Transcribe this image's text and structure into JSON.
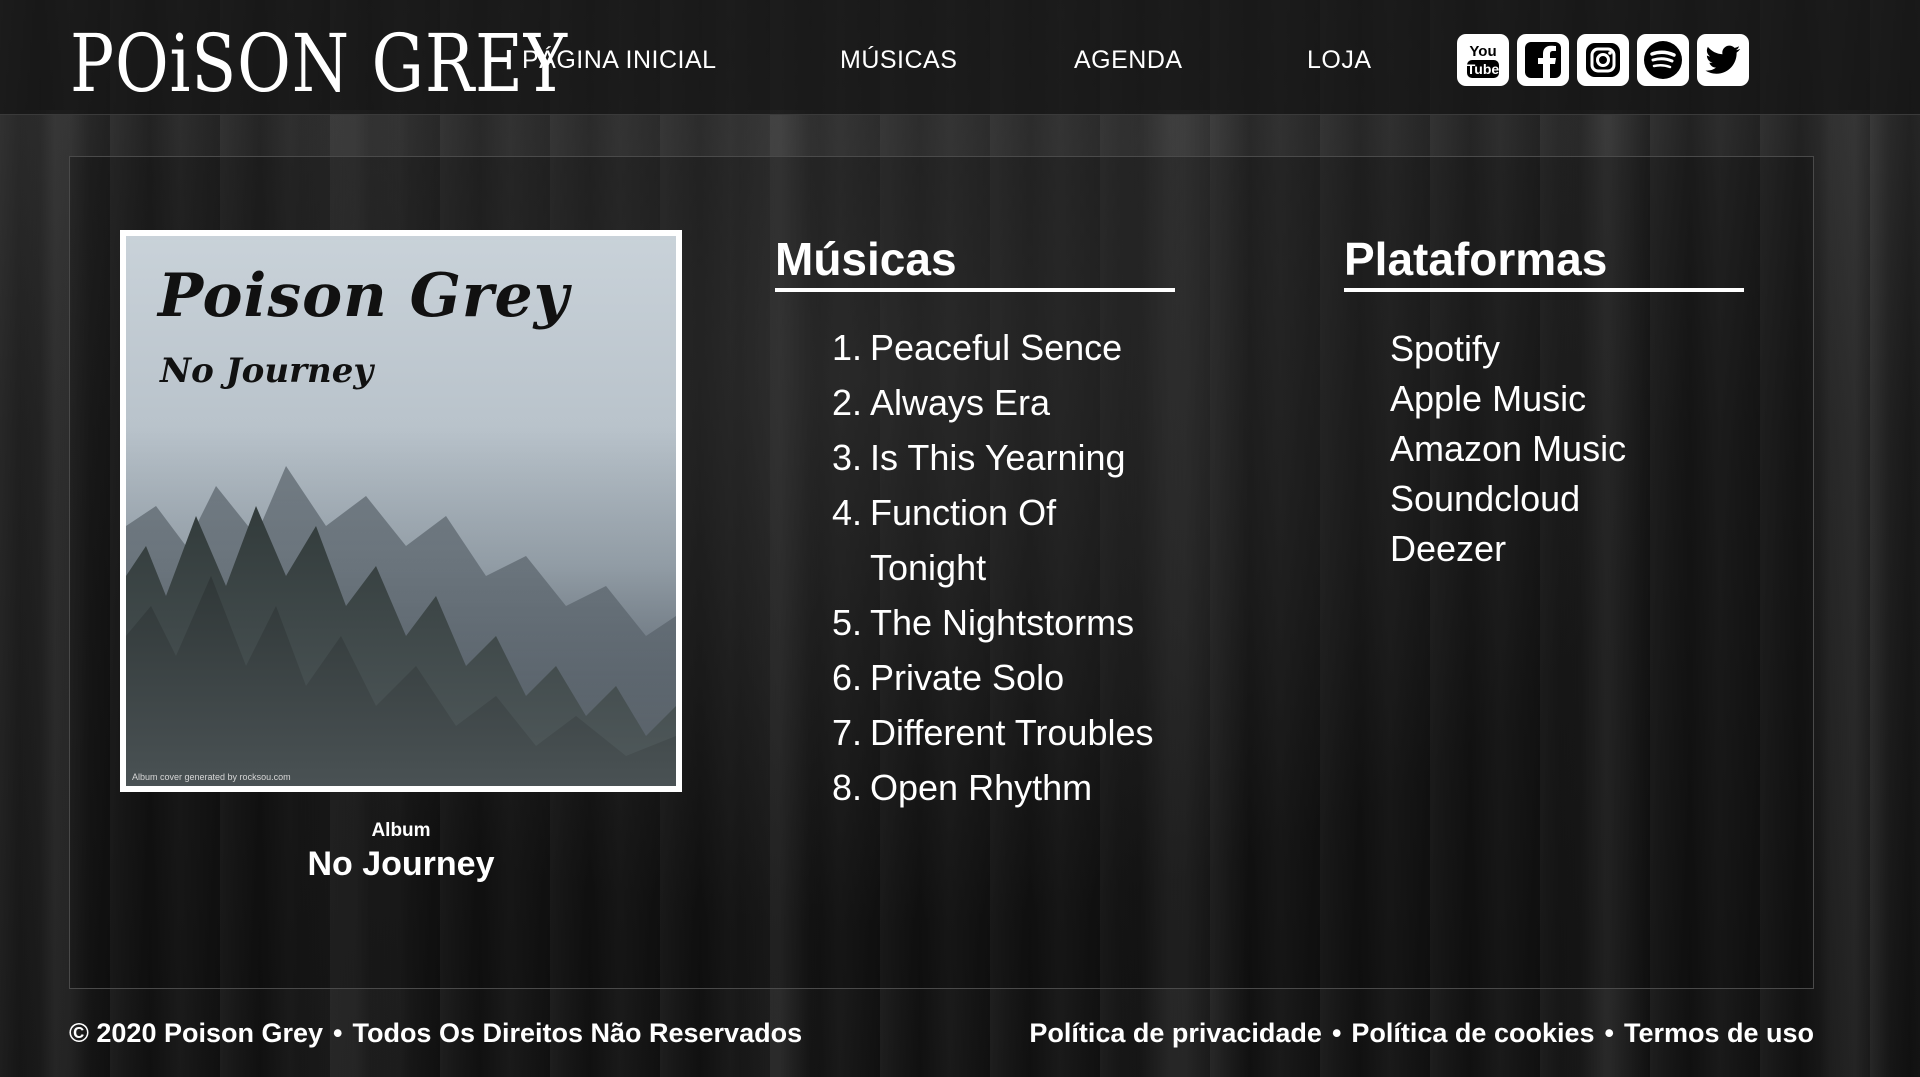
{
  "brand": "POiSON GREY",
  "nav": [
    {
      "label": "PÁGINA INICIAL"
    },
    {
      "label": "MÚSICAS"
    },
    {
      "label": "AGENDA"
    },
    {
      "label": "LOJA"
    }
  ],
  "social": [
    {
      "icon": "youtube-icon",
      "text": "You Tube"
    },
    {
      "icon": "facebook-icon"
    },
    {
      "icon": "instagram-icon"
    },
    {
      "icon": "spotify-icon"
    },
    {
      "icon": "twitter-icon"
    }
  ],
  "album": {
    "cover_band": "Poison Grey",
    "cover_title": "No Journey",
    "cover_credit": "Album cover generated by rocksou.com",
    "label": "Album",
    "name": "No Journey"
  },
  "musicas": {
    "heading": "Músicas",
    "tracks": [
      {
        "num": "1.",
        "title": "Peaceful Sence"
      },
      {
        "num": "2.",
        "title": "Always Era"
      },
      {
        "num": "3.",
        "title": "Is This Yearning"
      },
      {
        "num": "4.",
        "title": "Function Of Tonight"
      },
      {
        "num": "5.",
        "title": "The Nightstorms"
      },
      {
        "num": "6.",
        "title": "Private Solo"
      },
      {
        "num": "7.",
        "title": "Different Troubles"
      },
      {
        "num": "8.",
        "title": "Open Rhythm"
      }
    ]
  },
  "plataformas": {
    "heading": "Plataformas",
    "items": [
      "Spotify",
      "Apple Music",
      "Amazon Music",
      "Soundcloud",
      "Deezer"
    ]
  },
  "footer": {
    "copyright": "© 2020 Poison Grey",
    "rights": "Todos Os Direitos Não Reservados",
    "bullet": "•",
    "links": [
      "Política de privacidade",
      "Política de cookies",
      "Termos de uso"
    ]
  }
}
